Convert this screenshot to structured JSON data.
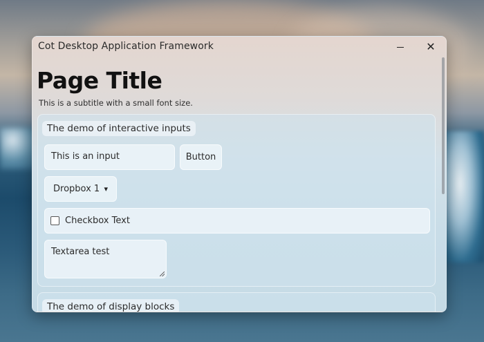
{
  "window": {
    "title": "Cot Desktop Application Framework",
    "controls": {
      "minimize_icon": "minimize-icon",
      "close_icon": "close-icon",
      "close_glyph": "✕"
    }
  },
  "page": {
    "title": "Page Title",
    "subtitle": "This is a subtitle with a small font size."
  },
  "interactive_panel": {
    "label": "The demo of interactive inputs",
    "input_value": "This is an input",
    "button_label": "Button",
    "dropdown_selected": "Dropbox 1",
    "checkbox_label": "Checkbox Text",
    "checkbox_checked": false,
    "textarea_value": "Textarea test"
  },
  "display_panel": {
    "label": "The demo of display blocks"
  },
  "colors": {
    "window_tint": "#dfdad8",
    "panel_bg": "#cde1ec",
    "control_bg": "#f0f6fa",
    "text": "#2b2b2b"
  }
}
